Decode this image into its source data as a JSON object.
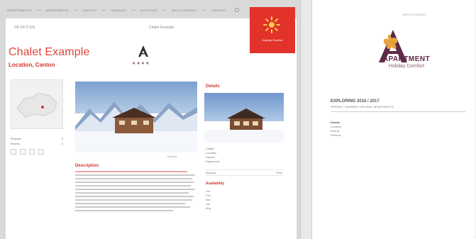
{
  "left_site": {
    "nav": [
      "APPARTEMENTS",
      "APPARTMENTS",
      "CHALETS",
      "HOLIDAYS",
      "ACTIVITIES",
      "INFO & CONTACT",
      "CONTACT"
    ],
    "top_meta_left": "DE FR IT EN",
    "top_meta_center": "Chalet Example",
    "title": "Chalet Example",
    "subtitle": "Location, Canton",
    "badge_text": "Holiday Comfort",
    "hero_caption": "Example",
    "body_title": "Description",
    "rc_header": "Details",
    "rc_list": [
      "Chalet",
      "Location",
      "Canton",
      "Equipment"
    ],
    "rc_box_left": "Booking",
    "rc_box_right": "Price",
    "rc_title": "Availability",
    "rc_items": [
      "Jan",
      "Feb",
      "Mar",
      "Apr",
      "May"
    ],
    "left_list": [
      {
        "label": "Persons",
        "value": "6"
      },
      {
        "label": "Rooms",
        "value": "3"
      }
    ]
  },
  "doc": {
    "topline": "INFO & CONTACT",
    "topline2": "",
    "brand": "APARTMENT",
    "brand_sub": "Holiday Comfort",
    "season": "EXPLORING 2016 / 2017",
    "season_sub": "SPRING / SUMMER HOLIDAY APARTMENTS",
    "block_title": "Details",
    "rows": [
      {
        "k": "Location",
        "v": ""
      },
      {
        "k": "Rooms",
        "v": ""
      },
      {
        "k": "Persons",
        "v": ""
      }
    ]
  }
}
